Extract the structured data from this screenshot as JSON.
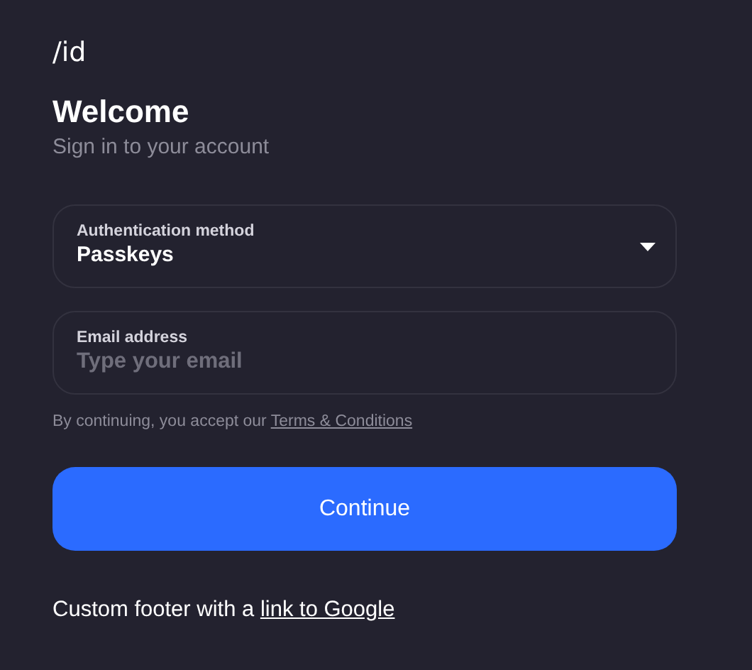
{
  "logo": "/id",
  "title": "Welcome",
  "subtitle": "Sign in to your account",
  "auth_method": {
    "label": "Authentication method",
    "value": "Passkeys"
  },
  "email": {
    "label": "Email address",
    "placeholder": "Type your email"
  },
  "terms": {
    "text": "By continuing, you accept our ",
    "link": "Terms & Conditions"
  },
  "continue_button": "Continue",
  "footer": {
    "text": "Custom footer with a ",
    "link": "link to Google"
  }
}
